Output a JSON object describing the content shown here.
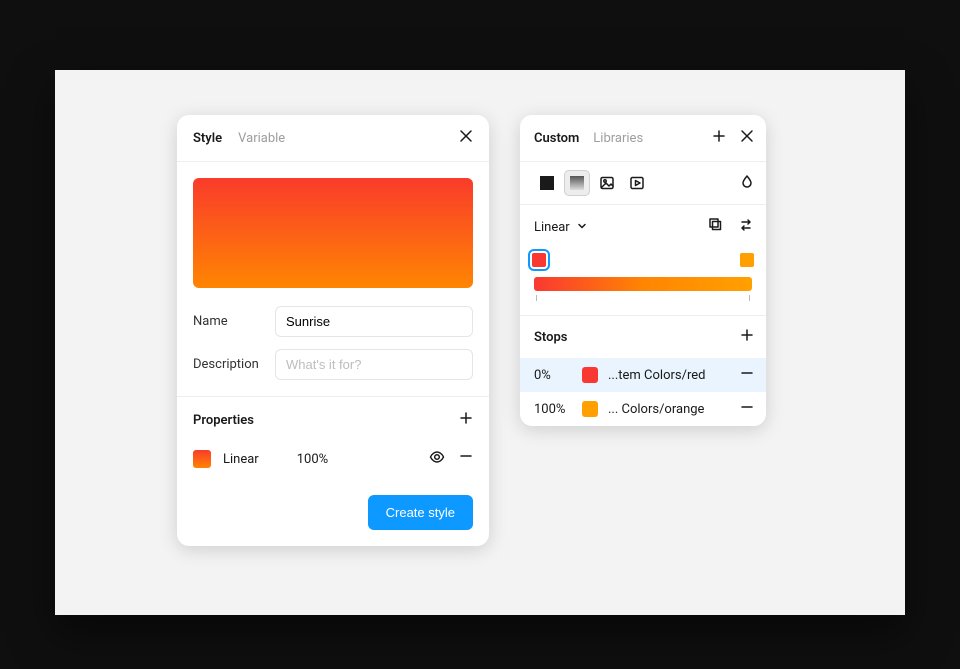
{
  "style_panel": {
    "tabs": {
      "active": "Style",
      "inactive": "Variable"
    },
    "name_label": "Name",
    "name_value": "Sunrise",
    "desc_label": "Description",
    "desc_placeholder": "What's it for?",
    "properties_label": "Properties",
    "prop_type": "Linear",
    "prop_opacity": "100%",
    "create_button": "Create style",
    "gradient_stops": [
      "#fa3b2b",
      "#ff8502"
    ]
  },
  "color_panel": {
    "tabs": {
      "active": "Custom",
      "inactive": "Libraries"
    },
    "blend_mode": "Linear",
    "stops_label": "Stops",
    "stops": [
      {
        "position": "0%",
        "color": "#fa3832",
        "name": "...tem Colors/red",
        "selected": true
      },
      {
        "position": "100%",
        "color": "#FFA000",
        "name": "... Colors/orange",
        "selected": false
      }
    ]
  }
}
